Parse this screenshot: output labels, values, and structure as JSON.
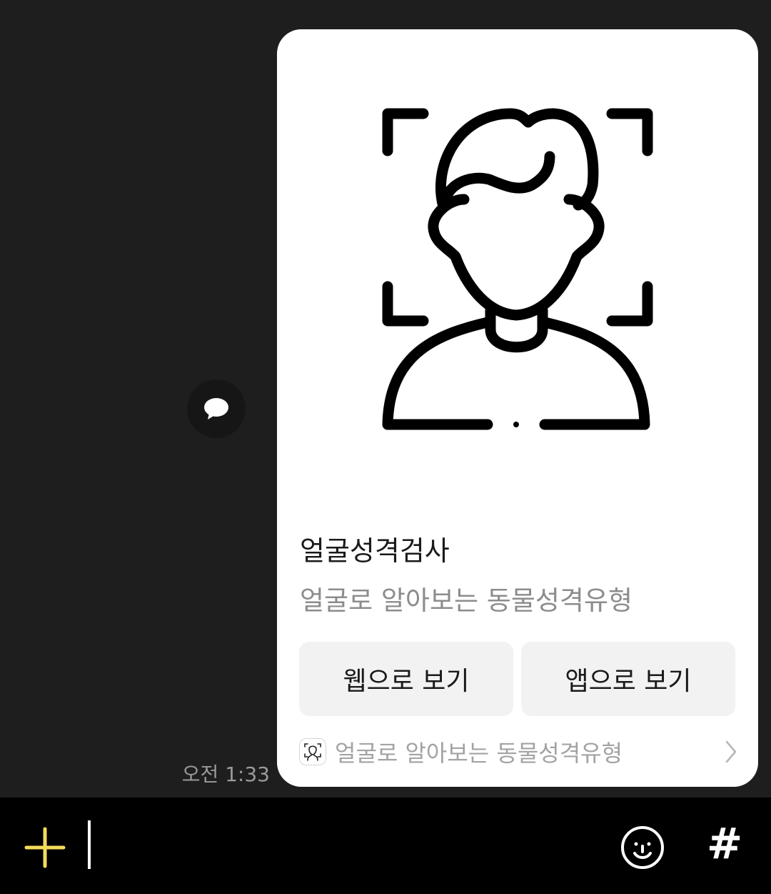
{
  "chat": {
    "timestamp": "오전 1:33",
    "card": {
      "image_icon": "face-scan-person-icon",
      "title": "얼굴성격검사",
      "description": "얼굴로 알아보는 동물성격유형",
      "buttons": {
        "web_label": "웹으로 보기",
        "app_label": "앱으로 보기"
      },
      "footer": {
        "icon": "face-scan-thumbnail-icon",
        "text": "얼굴로 알아보는 동물성격유형"
      }
    },
    "share_icon": "speech-bubble-icon"
  },
  "input_bar": {
    "plus_icon": "plus-icon",
    "emoji_icon": "smiley-icon",
    "hashtag_label": "#"
  },
  "colors": {
    "chat_background": "#1e1e1e",
    "input_bar_background": "#000000",
    "accent_yellow": "#f5dc5a",
    "card_background": "#ffffff",
    "button_background": "#f2f2f2"
  }
}
